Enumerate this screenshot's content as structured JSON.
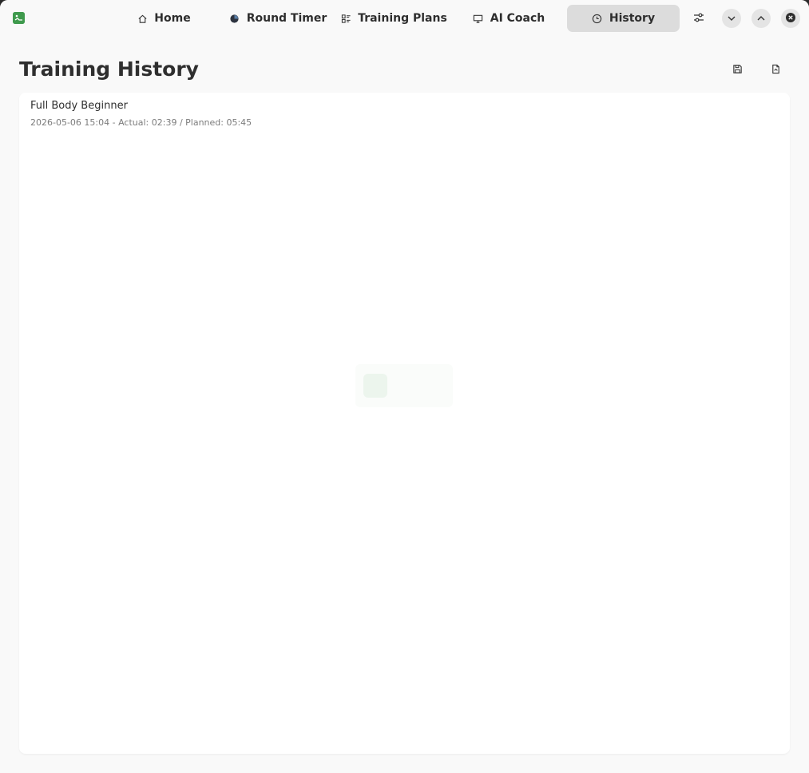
{
  "header": {
    "tabs": [
      {
        "label": "Home",
        "icon": "home-icon"
      },
      {
        "label": "Round Timer",
        "icon": "timer-icon"
      },
      {
        "label": "Training Plans",
        "icon": "list-icon"
      },
      {
        "label": "AI Coach",
        "icon": "monitor-icon"
      },
      {
        "label": "History",
        "icon": "clock-icon",
        "active": true
      }
    ],
    "buttons": [
      "settings-icon",
      "chevron-down-icon",
      "chevron-up-icon",
      "close-icon"
    ]
  },
  "page": {
    "title": "Training History",
    "actions": [
      "save-icon",
      "export-file-icon"
    ]
  },
  "history": {
    "items": [
      {
        "title": "Full Body Beginner",
        "subtitle": "2026-05-06 15:04 - Actual: 02:39 / Planned: 05:45"
      }
    ]
  },
  "colors": {
    "accent": "#3f9a4d",
    "active_tab": "#dcdcdc",
    "background": "#f9f9f9"
  }
}
